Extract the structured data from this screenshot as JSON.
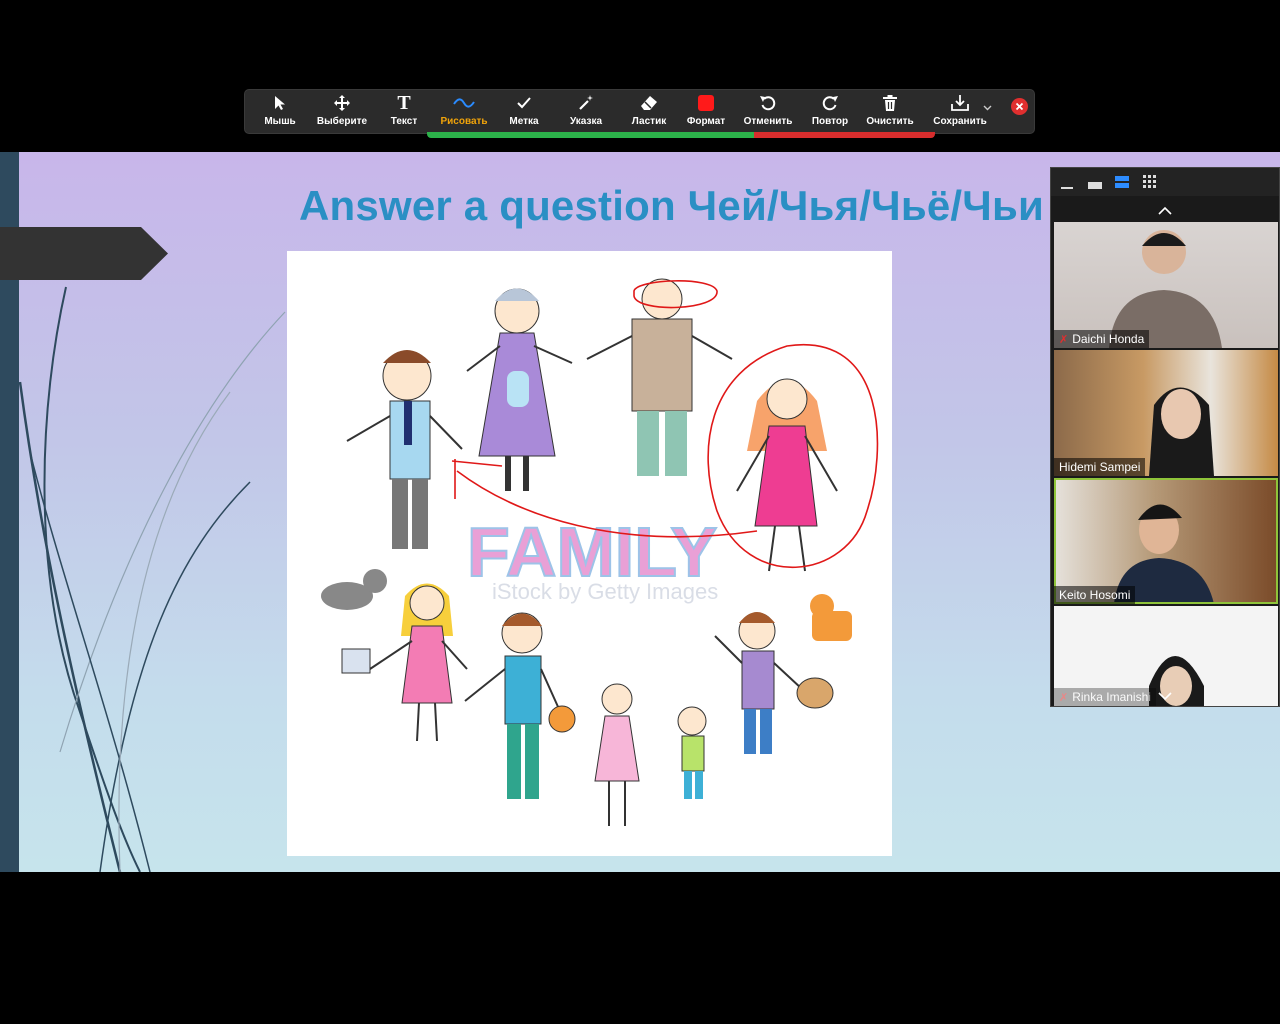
{
  "toolbar": {
    "tools": [
      {
        "name": "mouse",
        "label": "Мышь",
        "icon": "cursor-icon"
      },
      {
        "name": "select",
        "label": "Выберите",
        "icon": "move-icon"
      },
      {
        "name": "text",
        "label": "Текст",
        "icon": "text-icon"
      },
      {
        "name": "draw",
        "label": "Рисовать",
        "icon": "squiggle-icon",
        "active": true
      },
      {
        "name": "stamp",
        "label": "Метка",
        "icon": "checkmark-icon"
      },
      {
        "name": "spotlight",
        "label": "Указка",
        "icon": "magic-wand-icon"
      },
      {
        "name": "eraser",
        "label": "Ластик",
        "icon": "eraser-icon"
      },
      {
        "name": "format",
        "label": "Формат",
        "icon": "color-swatch-icon"
      },
      {
        "name": "undo",
        "label": "Отменить",
        "icon": "undo-icon"
      },
      {
        "name": "redo",
        "label": "Повтор",
        "icon": "redo-icon"
      },
      {
        "name": "clear",
        "label": "Очистить",
        "icon": "trash-icon"
      },
      {
        "name": "save",
        "label": "Сохранить",
        "icon": "download-icon"
      }
    ],
    "format_color": "#ff1a1a",
    "active_color": "#f0a30a"
  },
  "slide": {
    "title": "Answer a question Чей/Чья/Чьё/Чьи",
    "art_watermark": "iStock by Getty Images",
    "art_word": "FAMILY",
    "title_color": "#2a8fc4"
  },
  "participants": [
    {
      "name": "Daichi Honda",
      "muted": true
    },
    {
      "name": "Hidemi Sampei",
      "muted": false
    },
    {
      "name": "Keito Hosomi",
      "muted": false,
      "speaking": true
    },
    {
      "name": "Rinka Imanishi",
      "muted": true
    }
  ]
}
